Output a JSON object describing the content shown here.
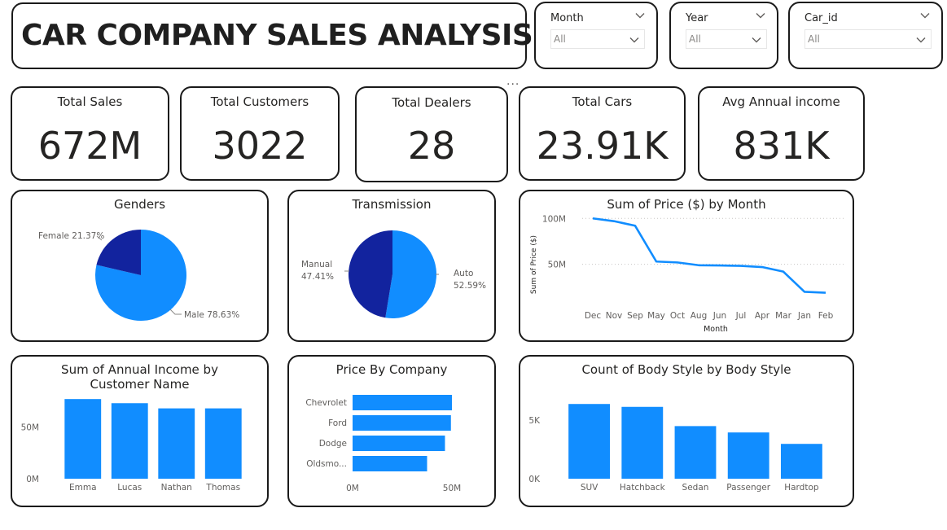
{
  "title": "CAR COMPANY SALES ANALYSIS",
  "slicers": [
    {
      "label": "Month",
      "value": "All",
      "icon": "chevron-down-icon"
    },
    {
      "label": "Year",
      "value": "All",
      "icon": "chevron-down-icon"
    },
    {
      "label": "Car_id",
      "value": "All",
      "icon": "chevron-down-icon"
    }
  ],
  "more_options": "...",
  "kpis": [
    {
      "label": "Total Sales",
      "value": "672M"
    },
    {
      "label": "Total Customers",
      "value": "3022"
    },
    {
      "label": "Total Dealers",
      "value": "28"
    },
    {
      "label": "Total Cars",
      "value": "23.91K"
    },
    {
      "label": "Avg Annual income",
      "value": "831K"
    }
  ],
  "colors": {
    "primary": "#118DFF",
    "dark": "#12239E",
    "border": "#1a1a1a"
  },
  "chart_data": [
    {
      "type": "pie",
      "title": "Genders",
      "slices": [
        {
          "label": "Male",
          "value": 78.63,
          "display": "Male 78.63%",
          "color": "#118DFF"
        },
        {
          "label": "Female",
          "value": 21.37,
          "display": "Female 21.37%",
          "color": "#12239E"
        }
      ]
    },
    {
      "type": "pie",
      "title": "Transmission",
      "slices": [
        {
          "label": "Auto",
          "value": 52.59,
          "display": [
            "Auto",
            "52.59%"
          ],
          "color": "#118DFF"
        },
        {
          "label": "Manual",
          "value": 47.41,
          "display": [
            "Manual",
            "47.41%"
          ],
          "color": "#12239E"
        }
      ]
    },
    {
      "type": "line",
      "title": "Sum of Price ($) by Month",
      "xlabel": "Month",
      "ylabel": "Sum of Price ($)",
      "categories": [
        "Dec",
        "Nov",
        "Sep",
        "May",
        "Oct",
        "Aug",
        "Jun",
        "Jul",
        "Apr",
        "Mar",
        "Jan",
        "Feb"
      ],
      "values": [
        100,
        97,
        92,
        53,
        52,
        49,
        48.7,
        48.3,
        47,
        42,
        20,
        19
      ],
      "yticks": [
        {
          "value": 100,
          "label": "100M"
        },
        {
          "value": 50,
          "label": "50M"
        }
      ],
      "ylim": [
        0,
        110
      ]
    },
    {
      "type": "bar",
      "title": "Sum of Annual Income by Customer Name",
      "categories": [
        "Emma",
        "Lucas",
        "Nathan",
        "Thomas"
      ],
      "values": [
        77,
        73,
        68,
        68
      ],
      "yticks": [
        {
          "value": 50,
          "label": "50M"
        },
        {
          "value": 0,
          "label": "0M"
        }
      ],
      "ylim": [
        0,
        85
      ]
    },
    {
      "type": "bar",
      "orientation": "horizontal",
      "title": "Price By Company",
      "categories": [
        "Chevrolet",
        "Ford",
        "Dodge",
        "Oldsmo..."
      ],
      "values": [
        50,
        49.5,
        46.5,
        37.5
      ],
      "xticks": [
        {
          "value": 0,
          "label": "0M"
        },
        {
          "value": 50,
          "label": "50M"
        }
      ],
      "xlim": [
        0,
        50
      ]
    },
    {
      "type": "bar",
      "title": "Count of Body Style by Body Style",
      "categories": [
        "SUV",
        "Hatchback",
        "Sedan",
        "Passenger",
        "Hardtop"
      ],
      "values": [
        6374,
        6128,
        4488,
        3945,
        2971
      ],
      "yticks": [
        {
          "value": 5000,
          "label": "5K"
        },
        {
          "value": 0,
          "label": "0K"
        }
      ],
      "ylim": [
        0,
        7500
      ]
    }
  ]
}
